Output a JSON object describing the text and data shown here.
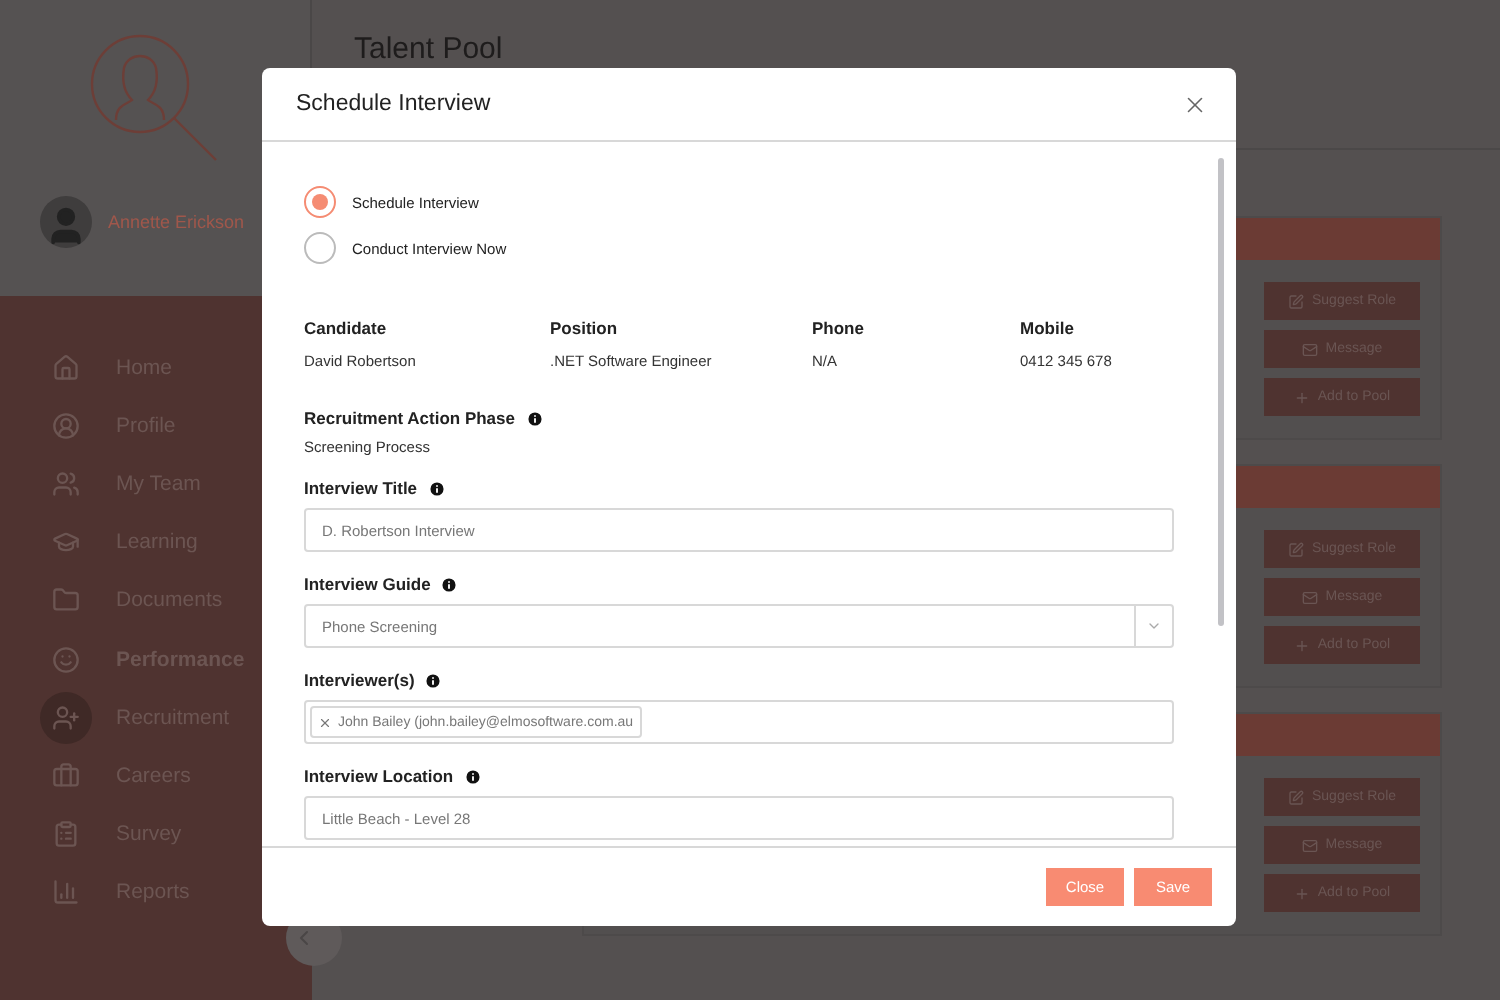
{
  "sidebar": {
    "user": {
      "name": "Annette Erickson"
    },
    "items": [
      {
        "label": "Home",
        "selected": false,
        "highlighted": false
      },
      {
        "label": "Profile",
        "selected": false,
        "highlighted": false
      },
      {
        "label": "My Team",
        "selected": false,
        "highlighted": false
      },
      {
        "label": "Learning",
        "selected": false,
        "highlighted": false
      },
      {
        "label": "Documents",
        "selected": false,
        "highlighted": false
      },
      {
        "label": "Performance",
        "selected": false,
        "highlighted": true
      },
      {
        "label": "Recruitment",
        "selected": true,
        "highlighted": false
      },
      {
        "label": "Careers",
        "selected": false,
        "highlighted": false
      },
      {
        "label": "Survey",
        "selected": false,
        "highlighted": false
      },
      {
        "label": "Reports",
        "selected": false,
        "highlighted": false
      }
    ]
  },
  "page": {
    "title": "Talent Pool",
    "cards": [
      {
        "buttons": [
          "Suggest Role",
          "Message",
          "Add to Pool"
        ]
      },
      {
        "buttons": [
          "Suggest Role",
          "Message",
          "Add to Pool"
        ]
      },
      {
        "buttons": [
          "Suggest Role",
          "Message",
          "Add to Pool"
        ]
      }
    ]
  },
  "modal": {
    "title": "Schedule Interview",
    "options": [
      {
        "label": "Schedule Interview",
        "selected": true
      },
      {
        "label": "Conduct Interview Now",
        "selected": false
      }
    ],
    "details": [
      {
        "label": "Candidate",
        "value": "David Robertson"
      },
      {
        "label": "Position",
        "value": ".NET Software Engineer"
      },
      {
        "label": "Phone",
        "value": "N/A"
      },
      {
        "label": "Mobile",
        "value": "0412 345 678"
      }
    ],
    "phase": {
      "label": "Recruitment Action Phase",
      "value": "Screening Process"
    },
    "fields": [
      {
        "kind": "text",
        "label": "Interview Title",
        "value": "D. Robertson Interview"
      },
      {
        "kind": "select",
        "label": "Interview Guide",
        "value": "Phone Screening"
      },
      {
        "kind": "tags",
        "label": "Interviewer(s)",
        "tags": [
          "John Bailey (john.bailey@elmosoftware.com.au"
        ]
      },
      {
        "kind": "text",
        "label": "Interview Location",
        "value": "Little Beach - Level 28"
      }
    ],
    "buttons": [
      "Close",
      "Save"
    ]
  }
}
